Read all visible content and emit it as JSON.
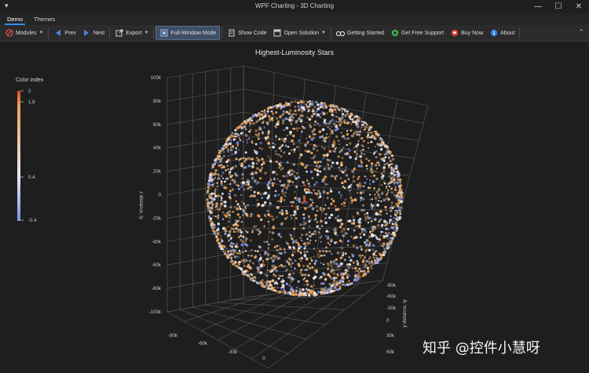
{
  "window": {
    "title": "WPF Charting - 3D Charting",
    "sysmenu": "▾",
    "min": "—",
    "max": "☐",
    "close": "✕"
  },
  "tabs": [
    {
      "label": "Demo",
      "active": true
    },
    {
      "label": "Themes",
      "active": false
    }
  ],
  "toolbar": {
    "modules": "Modules",
    "prev": "Prev",
    "next": "Next",
    "export": "Export",
    "fullwindow": "Full-Window Mode",
    "showcode": "Show Code",
    "opensolution": "Open Solution",
    "gettingstarted": "Getting Started",
    "support": "Get Free Support",
    "buynow": "Buy Now",
    "about": "About",
    "collapse": "⌃"
  },
  "colors": {
    "low": "#7a93e8",
    "mid": "#eaeaf0",
    "high": "#e8a25c",
    "top": "#e34f1c",
    "accent": "#2f8fe8"
  },
  "chart_data": {
    "type": "scatter3d",
    "title": "Highest-Luminosity Stars",
    "ylabel": "z distance, ly",
    "zlabel": "y distance, ly",
    "xlim": [
      -100000,
      100000
    ],
    "ylim": [
      -100000,
      100000
    ],
    "zlim": [
      -100000,
      100000
    ],
    "y_ticks": [
      "100k",
      "80k",
      "60k",
      "40k",
      "20k",
      "0",
      "-20k",
      "-40k",
      "-60k",
      "-80k",
      "-100k"
    ],
    "x_ticks": [
      "-90k",
      "-60k",
      "-30k",
      "0"
    ],
    "z_ticks": [
      "-90k",
      "-60k",
      "-30k",
      "0",
      "30k",
      "60k"
    ],
    "grid": true,
    "colorbar": {
      "title": "Color index",
      "ticks": [
        "2",
        "1.8",
        "0.4",
        "-0.4"
      ],
      "range": [
        -0.4,
        2
      ]
    }
  },
  "watermark": "知乎 @控件小慧呀"
}
